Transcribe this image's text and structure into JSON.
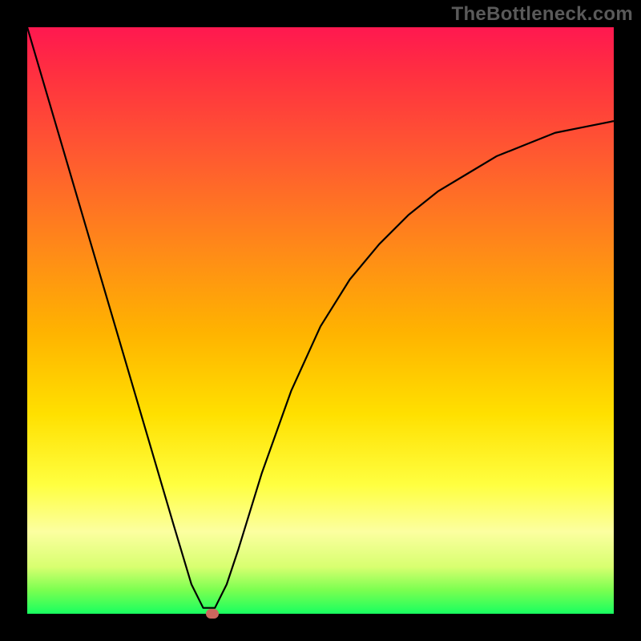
{
  "watermark": "TheBottleneck.com",
  "chart_data": {
    "type": "line",
    "title": "",
    "xlabel": "",
    "ylabel": "",
    "xlim": [
      0,
      1
    ],
    "ylim": [
      0,
      1
    ],
    "series": [
      {
        "name": "curve",
        "x": [
          0.0,
          0.05,
          0.1,
          0.15,
          0.2,
          0.25,
          0.28,
          0.3,
          0.31,
          0.32,
          0.34,
          0.36,
          0.4,
          0.45,
          0.5,
          0.55,
          0.6,
          0.65,
          0.7,
          0.75,
          0.8,
          0.85,
          0.9,
          0.95,
          1.0
        ],
        "y": [
          1.0,
          0.83,
          0.66,
          0.49,
          0.32,
          0.15,
          0.05,
          0.01,
          0.01,
          0.01,
          0.05,
          0.11,
          0.24,
          0.38,
          0.49,
          0.57,
          0.63,
          0.68,
          0.72,
          0.75,
          0.78,
          0.8,
          0.82,
          0.83,
          0.84
        ]
      }
    ],
    "marker": {
      "x": 0.315,
      "y": 0.0
    },
    "colors": {
      "curve": "#000000",
      "marker": "#cc665e",
      "gradient_top": "#ff1850",
      "gradient_bottom": "#18ff60",
      "frame": "#000000"
    }
  }
}
